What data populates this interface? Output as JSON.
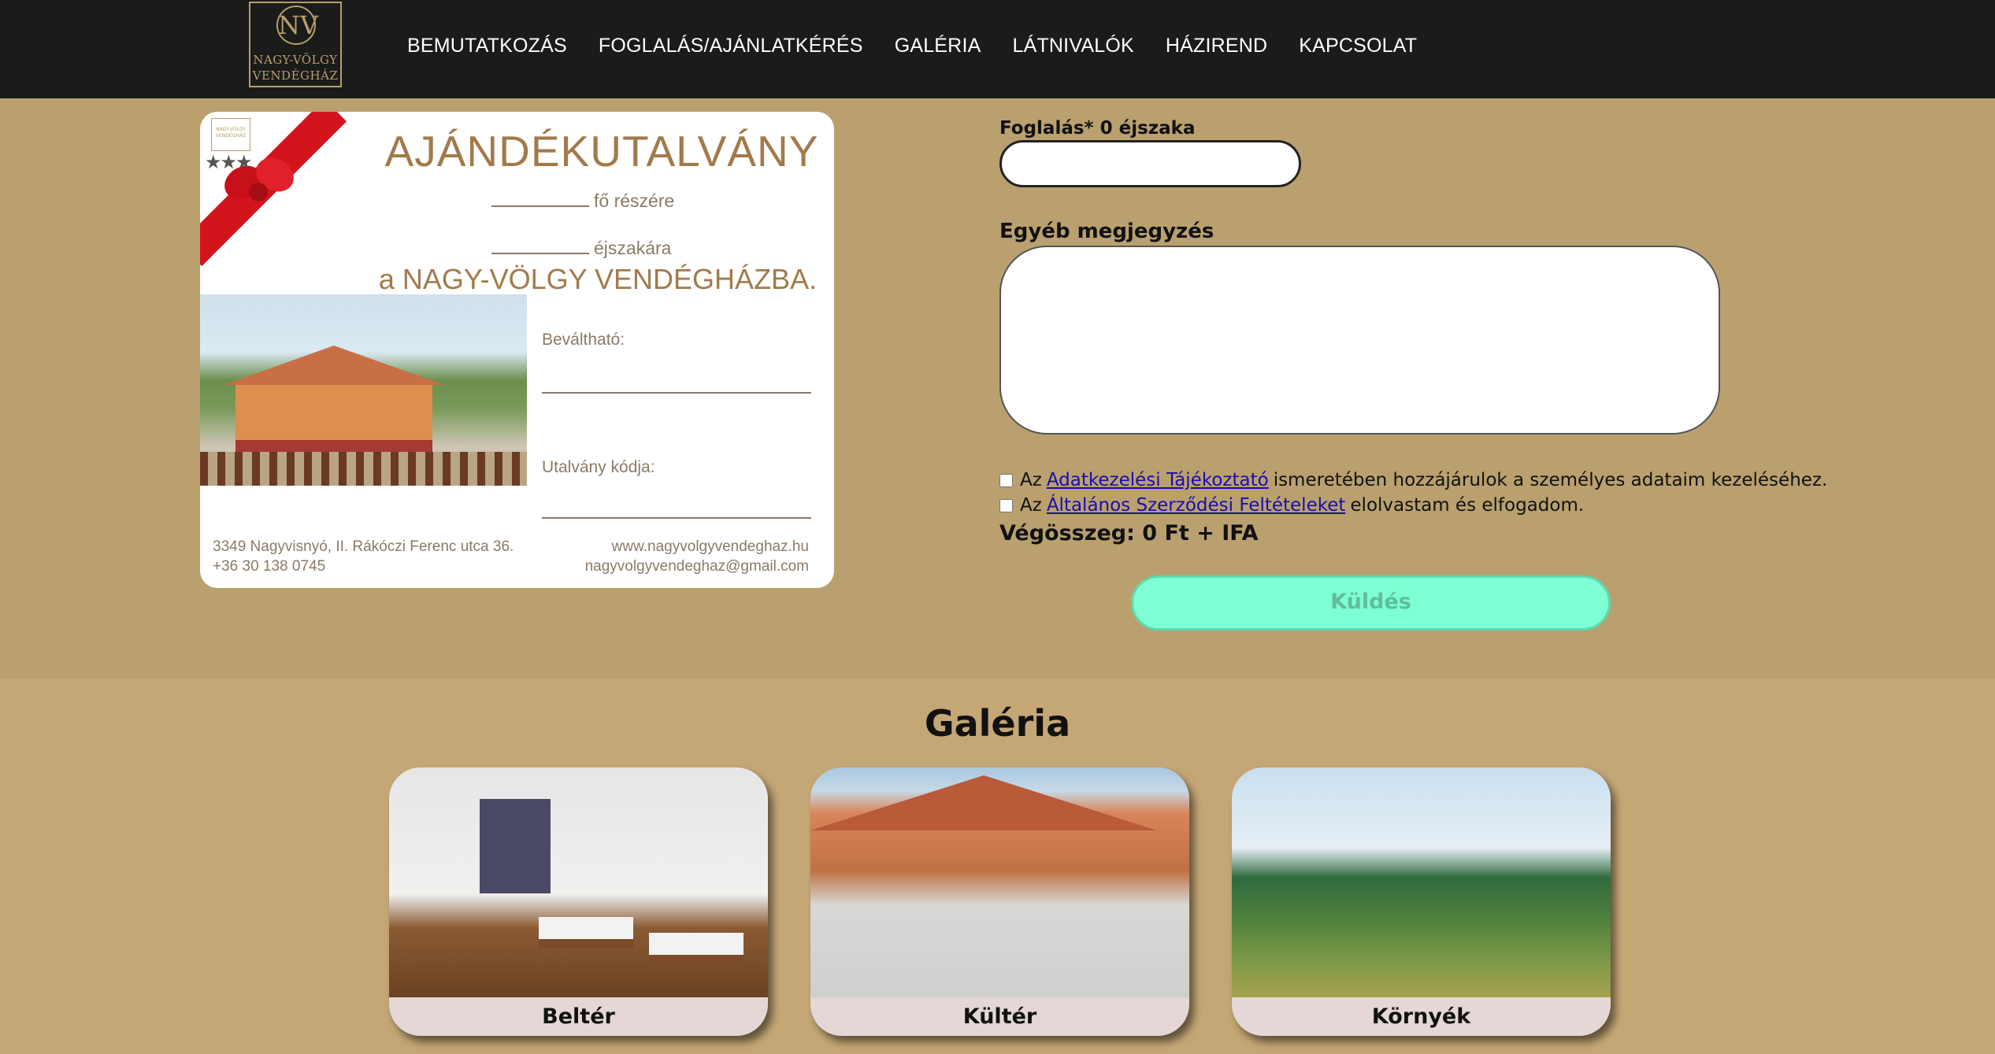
{
  "nav": {
    "logo_monogram": "NV",
    "logo_line1": "NAGY-VÖLGY",
    "logo_line2": "VENDÉGHÁZ",
    "items": [
      {
        "label": "BEMUTATKOZÁS"
      },
      {
        "label": "FOGLALÁS/AJÁNLATKÉRÉS"
      },
      {
        "label": "GALÉRIA"
      },
      {
        "label": "LÁTNIVALÓK"
      },
      {
        "label": "HÁZIREND"
      },
      {
        "label": "KAPCSOLAT"
      }
    ]
  },
  "voucher": {
    "title": "AJÁNDÉKUTALVÁNY",
    "line1": "fő részére",
    "line2": "éjszakára",
    "subtitle": "a NAGY-VÖLGY VENDÉGHÁZBA.",
    "stars": "★★★",
    "field1": "Beváltható:",
    "field2": "Utalvány kódja:",
    "address": "3349 Nagyvisnyó, II. Rákóczi Ferenc utca 36.",
    "phone": "+36 30 138 0745",
    "website": "www.nagyvolgyvendeghaz.hu",
    "email": "nagyvolgyvendeghaz@gmail.com"
  },
  "form": {
    "booking_label": "Foglalás* 0 éjszaka",
    "booking_value": "",
    "note_label": "Egyéb megjegyzés",
    "note_value": "",
    "consent1": {
      "prefix": "Az",
      "link": "Adatkezelési Tájékoztató",
      "suffix": "ismeretében hozzájárulok a személyes adataim kezeléséhez."
    },
    "consent2": {
      "prefix": "Az",
      "link": "Általános Szerződési Feltételeket",
      "suffix": "elolvastam és elfogadom."
    },
    "total": "Végösszeg: 0 Ft + IFA",
    "send_label": "Küldés"
  },
  "gallery": {
    "title": "Galéria",
    "cards": [
      {
        "label": "Beltér"
      },
      {
        "label": "Kültér"
      },
      {
        "label": "Környék"
      }
    ]
  },
  "colors": {
    "nav_bg": "#1b1b1b",
    "page_bg": "#b9a06e",
    "gallery_bg": "#c4a775",
    "send_bg": "#7fffd4",
    "link": "#1a0dab"
  }
}
